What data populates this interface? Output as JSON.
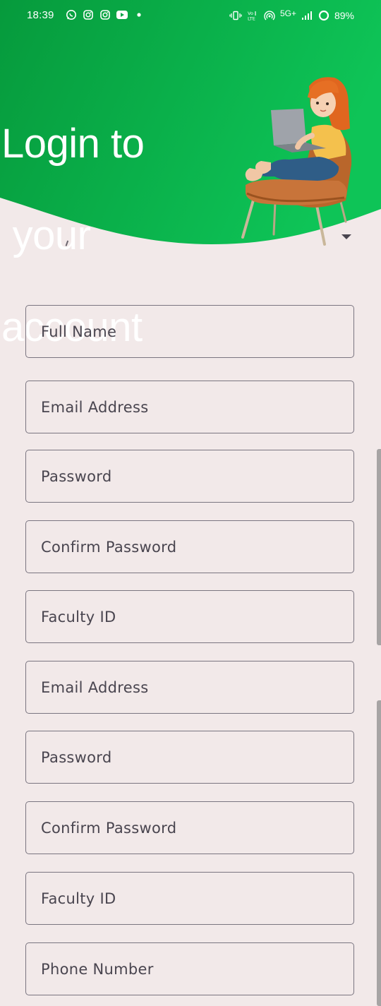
{
  "status_bar": {
    "time": "18:39",
    "left_icons": [
      "whatsapp-icon",
      "instagram-icon",
      "instagram-icon",
      "youtube-icon",
      "dot-icon"
    ],
    "network_label": "5G+",
    "battery": "89%"
  },
  "header": {
    "title_lines": [
      "Login to",
      " your",
      "account"
    ],
    "colors": {
      "green_start": "#069a3c",
      "green_end": "#0ec457",
      "background": "#f2e9e9"
    }
  },
  "form": {
    "fields": [
      {
        "placeholder": "Full Name",
        "value": ""
      },
      {
        "placeholder": "Email Address",
        "value": ""
      },
      {
        "placeholder": "Password",
        "value": ""
      },
      {
        "placeholder": "Confirm Password",
        "value": ""
      },
      {
        "placeholder": "Faculty ID",
        "value": ""
      },
      {
        "placeholder": "Email Address",
        "value": ""
      },
      {
        "placeholder": "Password",
        "value": ""
      },
      {
        "placeholder": "Confirm Password",
        "value": ""
      },
      {
        "placeholder": "Faculty ID",
        "value": ""
      },
      {
        "placeholder": "Phone Number",
        "value": ""
      }
    ]
  }
}
